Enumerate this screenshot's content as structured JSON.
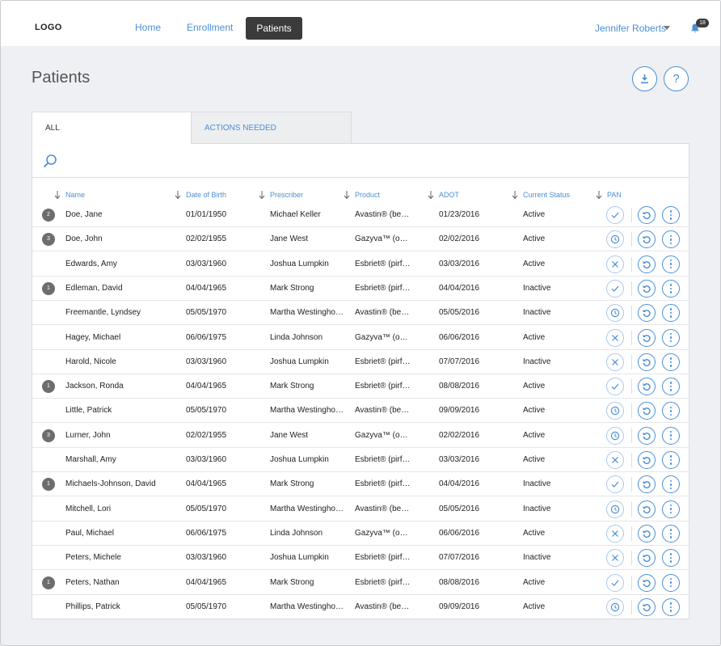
{
  "header": {
    "logo": "LOGO",
    "nav": [
      {
        "label": "Home",
        "active": false
      },
      {
        "label": "Enrollment",
        "active": false
      },
      {
        "label": "Patients",
        "active": true
      }
    ],
    "user": "Jennifer Roberts",
    "notification_count": "18"
  },
  "page": {
    "title": "Patients",
    "help_label": "?"
  },
  "tabs": [
    {
      "label": "ALL",
      "active": true
    },
    {
      "label": "ACTIONS NEEDED",
      "active": false
    }
  ],
  "columns": [
    "Name",
    "Date of Birth",
    "Prescriber",
    "Product",
    "ADOT",
    "Current Status",
    "PAN"
  ],
  "rows": [
    {
      "count": "2",
      "name": "Doe, Jane",
      "dob": "01/01/1950",
      "prescriber": "Michael Keller",
      "product": "Avastin® (bevacizumab)",
      "adot": "01/23/2016",
      "status": "Active",
      "pan": "check"
    },
    {
      "count": "3",
      "name": "Doe, John",
      "dob": "02/02/1955",
      "prescriber": "Jane West",
      "product": "Gazyva™ (obinutuzumab)",
      "adot": "02/02/2016",
      "status": "Active",
      "pan": "clock"
    },
    {
      "count": "",
      "name": "Edwards, Amy",
      "dob": "03/03/1960",
      "prescriber": "Joshua Lumpkin",
      "product": "Esbriet® (pirfenidone)",
      "adot": "03/03/2016",
      "status": "Active",
      "pan": "x"
    },
    {
      "count": "1",
      "name": "Edleman, David",
      "dob": "04/04/1965",
      "prescriber": "Mark Strong",
      "product": "Esbriet® (pirfenidone)",
      "adot": "04/04/2016",
      "status": "Inactive",
      "pan": "check"
    },
    {
      "count": "",
      "name": "Freemantle, Lyndsey",
      "dob": "05/05/1970",
      "prescriber": "Martha Westinghouse",
      "product": "Avastin® (bevacizumab)",
      "adot": "05/05/2016",
      "status": "Inactive",
      "pan": "clock"
    },
    {
      "count": "",
      "name": "Hagey, Michael",
      "dob": "06/06/1975",
      "prescriber": "Linda Johnson",
      "product": "Gazyva™ (obinutuzumab)",
      "adot": "06/06/2016",
      "status": "Active",
      "pan": "x"
    },
    {
      "count": "",
      "name": "Harold, Nicole",
      "dob": "03/03/1960",
      "prescriber": "Joshua Lumpkin",
      "product": "Esbriet® (pirfenidone)",
      "adot": "07/07/2016",
      "status": "Inactive",
      "pan": "x"
    },
    {
      "count": "1",
      "name": "Jackson, Ronda",
      "dob": "04/04/1965",
      "prescriber": "Mark Strong",
      "product": "Esbriet® (pirfenidone)",
      "adot": "08/08/2016",
      "status": "Active",
      "pan": "check"
    },
    {
      "count": "",
      "name": "Little, Patrick",
      "dob": "05/05/1970",
      "prescriber": "Martha Westinghouse",
      "product": "Avastin® (bevacizumab)",
      "adot": "09/09/2016",
      "status": "Active",
      "pan": "clock"
    },
    {
      "count": "3",
      "name": "Lurner, John",
      "dob": "02/02/1955",
      "prescriber": "Jane West",
      "product": "Gazyva™ (obinutuzumab)",
      "adot": "02/02/2016",
      "status": "Active",
      "pan": "clock"
    },
    {
      "count": "",
      "name": "Marshall, Amy",
      "dob": "03/03/1960",
      "prescriber": "Joshua Lumpkin",
      "product": "Esbriet® (pirfenidone)",
      "adot": "03/03/2016",
      "status": "Active",
      "pan": "x"
    },
    {
      "count": "1",
      "name": "Michaels-Johnson, David",
      "dob": "04/04/1965",
      "prescriber": "Mark Strong",
      "product": "Esbriet® (pirfenidone)",
      "adot": "04/04/2016",
      "status": "Inactive",
      "pan": "check"
    },
    {
      "count": "",
      "name": "Mitchell, Lori",
      "dob": "05/05/1970",
      "prescriber": "Martha Westinghouse",
      "product": "Avastin® (bevacizumab)",
      "adot": "05/05/2016",
      "status": "Inactive",
      "pan": "clock"
    },
    {
      "count": "",
      "name": "Paul, Michael",
      "dob": "06/06/1975",
      "prescriber": "Linda Johnson",
      "product": "Gazyva™ (obinutuzumab)",
      "adot": "06/06/2016",
      "status": "Active",
      "pan": "x"
    },
    {
      "count": "",
      "name": "Peters, Michele",
      "dob": "03/03/1960",
      "prescriber": "Joshua Lumpkin",
      "product": "Esbriet® (pirfenidone)",
      "adot": "07/07/2016",
      "status": "Inactive",
      "pan": "x"
    },
    {
      "count": "1",
      "name": "Peters, Nathan",
      "dob": "04/04/1965",
      "prescriber": "Mark Strong",
      "product": "Esbriet® (pirfenidone)",
      "adot": "08/08/2016",
      "status": "Active",
      "pan": "check"
    },
    {
      "count": "",
      "name": "Phillips, Patrick",
      "dob": "05/05/1970",
      "prescriber": "Martha Westinghouse",
      "product": "Avastin® (bevacizumab)",
      "adot": "09/09/2016",
      "status": "Active",
      "pan": "clock"
    }
  ],
  "colors": {
    "accent": "#4a8fd6",
    "dark": "#3b3b3b",
    "background": "#eef0f3"
  }
}
